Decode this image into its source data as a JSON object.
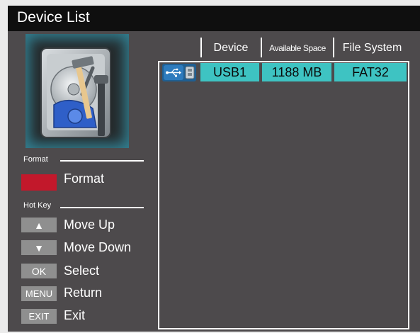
{
  "window": {
    "title": "Device List"
  },
  "sections": {
    "format_label": "Format",
    "hotkey_label": "Hot Key"
  },
  "actions": {
    "format": {
      "label": "Format",
      "color": "#c2182b"
    }
  },
  "hotkeys": [
    {
      "key": "▲",
      "label": "Move Up",
      "icon": "arrow-up-icon"
    },
    {
      "key": "▼",
      "label": "Move Down",
      "icon": "arrow-down-icon"
    },
    {
      "key": "OK",
      "label": "Select"
    },
    {
      "key": "MENU",
      "label": "Return"
    },
    {
      "key": "EXIT",
      "label": "Exit"
    }
  ],
  "table": {
    "columns": [
      "Device",
      "Available Space",
      "File System"
    ],
    "rows": [
      {
        "icon": "usb-drive-icon",
        "device": "USB1",
        "space": "1188 MB",
        "fs": "FAT32"
      }
    ]
  },
  "colors": {
    "selection": "#3ec3c2",
    "panel": "#4d4a4c",
    "titlebar": "#0f0f0f",
    "accent_glow": "#3ec6e6"
  }
}
